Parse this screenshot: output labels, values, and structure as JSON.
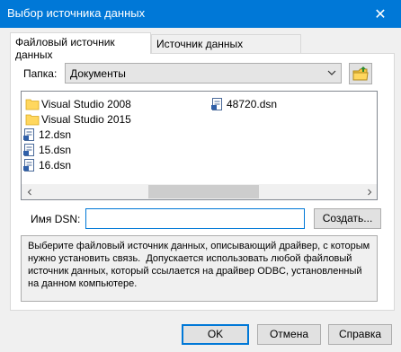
{
  "window": {
    "title": "Выбор источника данных",
    "close_glyph": "✕"
  },
  "tabs": [
    {
      "label": "Файловый источник данных",
      "active": true
    },
    {
      "label": "Источник данных компьютера",
      "active": false
    }
  ],
  "folder": {
    "label": "Папка:",
    "value": "Документы",
    "dropdown_icon": "chevron-down-icon",
    "up_button_icon": "folder-up-icon"
  },
  "files": [
    {
      "name": "Visual Studio 2008",
      "type": "folder"
    },
    {
      "name": "Visual Studio 2015",
      "type": "folder"
    },
    {
      "name": "12.dsn",
      "type": "dsn"
    },
    {
      "name": "15.dsn",
      "type": "dsn"
    },
    {
      "name": "16.dsn",
      "type": "dsn"
    },
    {
      "name": "48720.dsn",
      "type": "dsn"
    }
  ],
  "dsn": {
    "label": "Имя DSN:",
    "value": "",
    "create_label": "Создать..."
  },
  "description": "Выберите файловый источник данных, описывающий драйвер, с которым нужно установить связь.  Допускается использовать любой файловый источник данных, который ссылается на драйвер ODBC, установленный на данном компьютере.",
  "footer": {
    "ok_label": "OK",
    "cancel_label": "Отмена",
    "help_label": "Справка"
  },
  "colors": {
    "titlebar": "#0078d7",
    "dialog_bg": "#f0f0f0",
    "folder_icon": "#ffd75e"
  }
}
